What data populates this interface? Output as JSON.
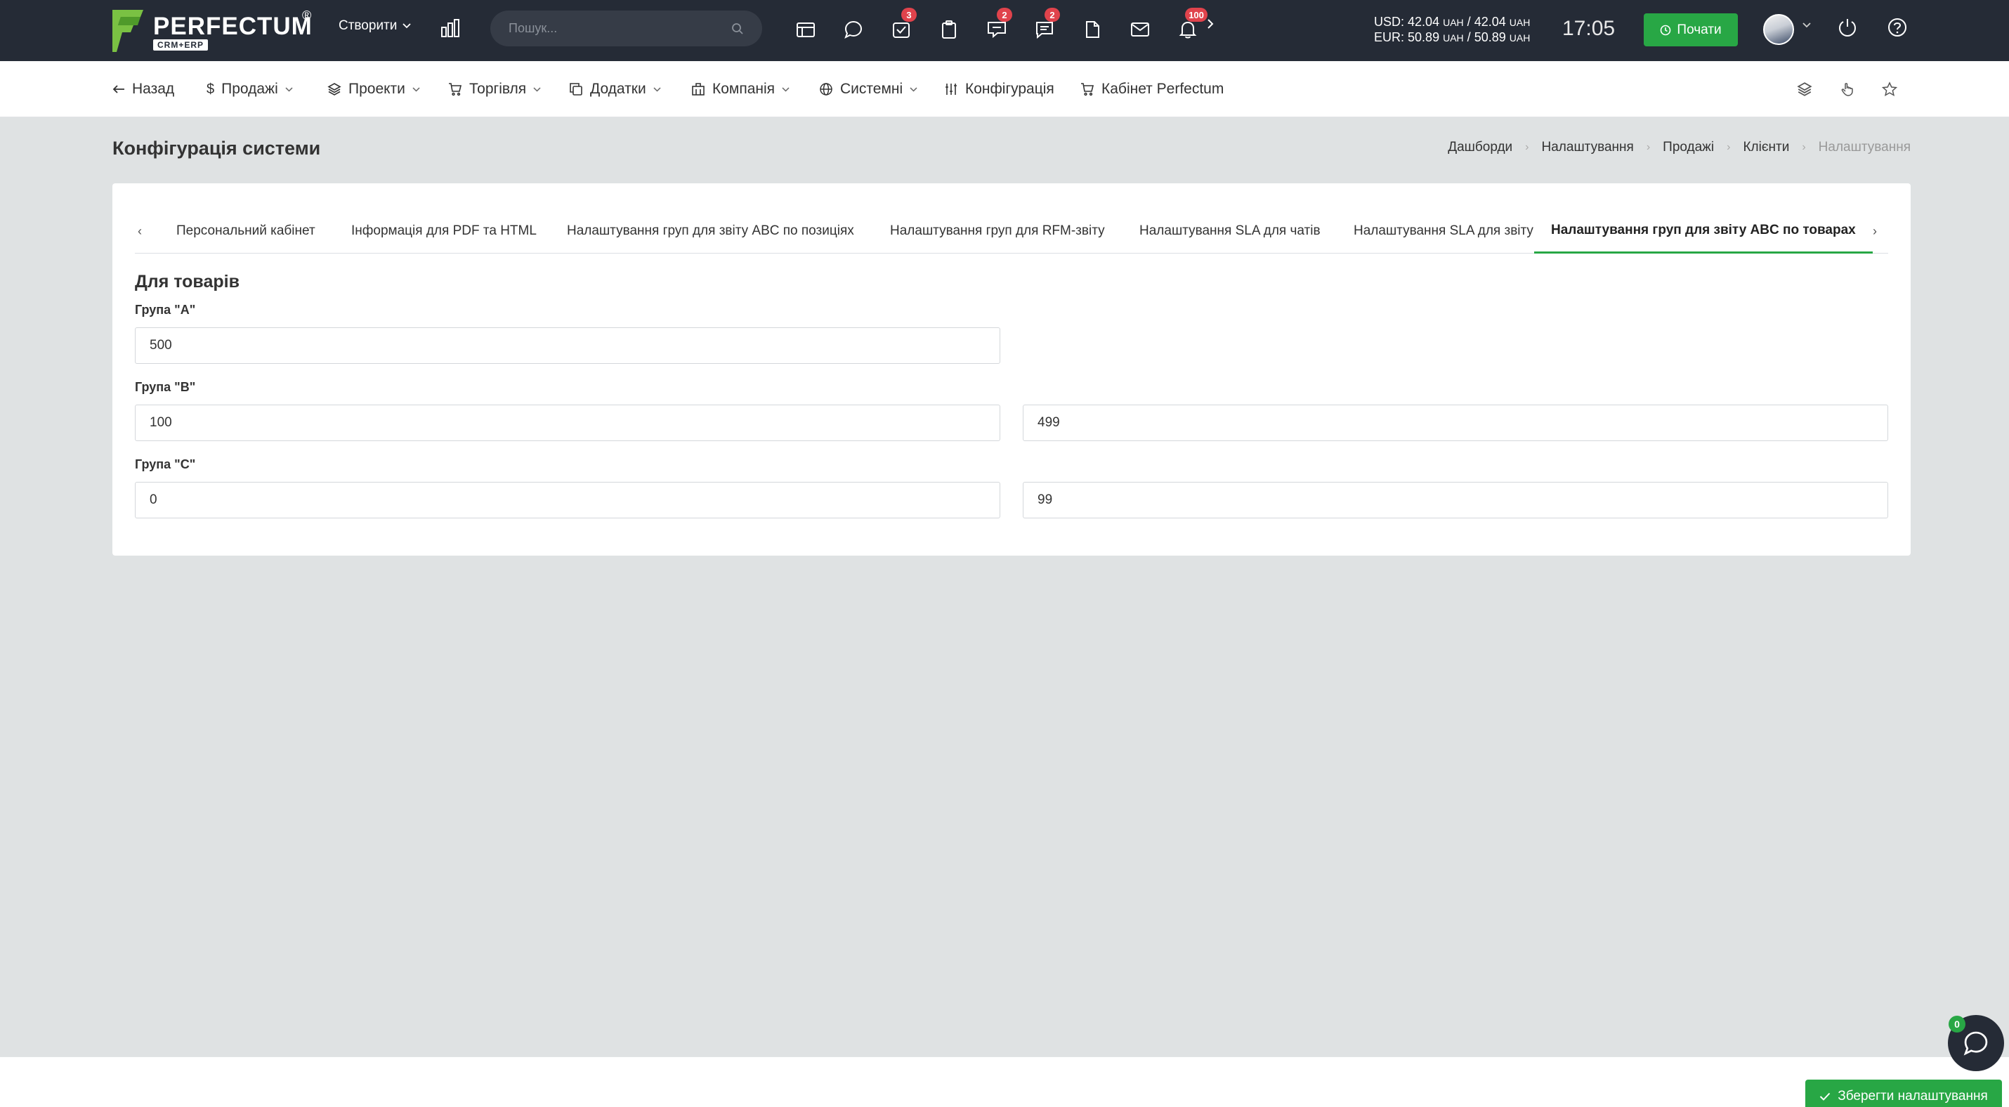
{
  "app": {
    "logo_text": "PERFECTUM",
    "logo_sub": "CRM+ERP",
    "logo_reg": "®",
    "brand_color": "#28a745",
    "topbar_color": "#252b36"
  },
  "topbar": {
    "create_label": "Створити",
    "search_placeholder": "Пошук...",
    "icons": [
      {
        "name": "calendar-icon",
        "badge": ""
      },
      {
        "name": "chat-bubble-icon",
        "badge": ""
      },
      {
        "name": "tasks-icon",
        "badge": "3"
      },
      {
        "name": "clipboard-icon",
        "badge": ""
      },
      {
        "name": "messages-icon",
        "badge": "2"
      },
      {
        "name": "comments-icon",
        "badge": "2"
      },
      {
        "name": "document-icon",
        "badge": ""
      },
      {
        "name": "mail-icon",
        "badge": ""
      },
      {
        "name": "bell-icon",
        "badge": "100"
      }
    ],
    "rates": {
      "usd_label": "USD:",
      "usd_buy": "42.04",
      "usd_sell": "42.04",
      "eur_label": "EUR:",
      "eur_buy": "50.89",
      "eur_sell": "50.89",
      "currency": "UAH",
      "sep": "/"
    },
    "time": "17:05",
    "start_label": "Почати"
  },
  "nav": {
    "back": "Назад",
    "sales": "Продажі",
    "projects": "Проекти",
    "trade": "Торгівля",
    "addons": "Додатки",
    "company": "Компанія",
    "system": "Системні",
    "config": "Конфігурація",
    "cabinet": "Кабінет Perfectum"
  },
  "page": {
    "title": "Конфігурація системи",
    "breadcrumb": [
      "Дашборди",
      "Налаштування",
      "Продажі",
      "Клієнти",
      "Налаштування"
    ]
  },
  "tabs": [
    "Персональний кабінет",
    "Інформація для PDF та HTML",
    "Налаштування груп для звіту ABC по позиціях",
    "Налаштування груп для RFM-звіту",
    "Налаштування SLA для чатів",
    "Налаштування SLA для звіту",
    "Налаштування груп для звіту ABC по товарах"
  ],
  "active_tab": 6,
  "form": {
    "section_title": "Для товарів",
    "group_a_label": "Група \"А\"",
    "group_a_value": "500",
    "group_b_label": "Група \"В\"",
    "group_b_from": "100",
    "group_b_to": "499",
    "group_c_label": "Група \"С\"",
    "group_c_from": "0",
    "group_c_to": "99"
  },
  "footer": {
    "save_label": "Зберегти налаштування",
    "chat_badge": "0"
  }
}
